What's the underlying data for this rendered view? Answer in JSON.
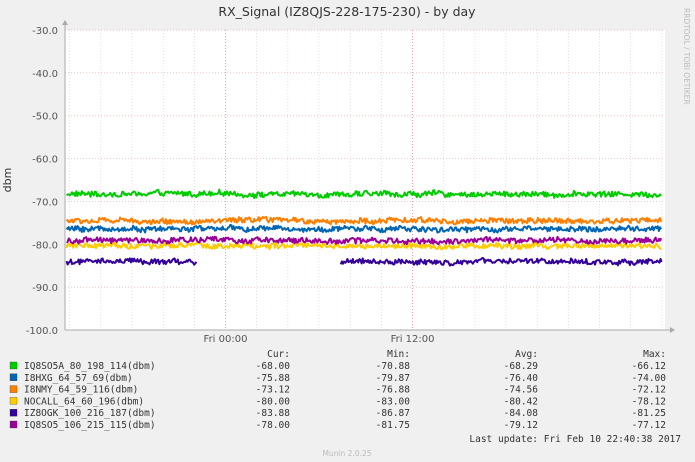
{
  "chart_data": {
    "type": "line",
    "title": "RX_Signal (IZ8QJS-228-175-230) - by day",
    "ylabel": "dbm",
    "ylim": [
      -100,
      -30
    ],
    "y_ticks": [
      "-30.0",
      "-40.0",
      "-50.0",
      "-60.0",
      "-70.0",
      "-80.0",
      "-90.0",
      "-100.0"
    ],
    "x_ticks": [
      "Fri 00:00",
      "Fri 12:00"
    ],
    "x_range_hours": [
      -10.3,
      28.2
    ],
    "grid": true,
    "side_label": "RRDTOOL / TOBI OETIKER",
    "legend_headers": {
      "cur": "Cur:",
      "min": "Min:",
      "avg": "Avg:",
      "max": "Max:"
    },
    "series": [
      {
        "name": "IQ8SO5A_80_198_114(dbm)",
        "color": "#00cc00",
        "base": -68.29,
        "noise": 0.6,
        "segments": [
          [
            -10.2,
            28.0
          ]
        ],
        "cur": "-68.00",
        "min": "-70.88",
        "avg": "-68.29",
        "max": "-66.12"
      },
      {
        "name": "I8HXG_64_57_69(dbm)",
        "color": "#0066b3",
        "base": -76.4,
        "noise": 0.6,
        "segments": [
          [
            -10.2,
            28.0
          ]
        ],
        "cur": "-75.88",
        "min": "-79.87",
        "avg": "-76.40",
        "max": "-74.00"
      },
      {
        "name": "I8NMY_64_59_116(dbm)",
        "color": "#ff8000",
        "base": -74.56,
        "noise": 0.6,
        "segments": [
          [
            -10.2,
            28.0
          ]
        ],
        "cur": "-73.12",
        "min": "-76.88",
        "avg": "-74.56",
        "max": "-72.12"
      },
      {
        "name": "NOCALL_64_60_196(dbm)",
        "color": "#ffcc00",
        "base": -80.42,
        "noise": 0.6,
        "segments": [
          [
            -10.2,
            28.0
          ]
        ],
        "cur": "-80.00",
        "min": "-83.00",
        "avg": "-80.42",
        "max": "-78.12"
      },
      {
        "name": "IZ8OGK_100_216_187(dbm)",
        "color": "#330099",
        "base": -84.08,
        "noise": 0.6,
        "segments": [
          [
            -10.2,
            -1.8
          ],
          [
            7.4,
            28.0
          ]
        ],
        "cur": "-83.88",
        "min": "-86.87",
        "avg": "-84.08",
        "max": "-81.25"
      },
      {
        "name": "IQ8SO5_106_215_115(dbm)",
        "color": "#990099",
        "base": -79.12,
        "noise": 0.6,
        "segments": [
          [
            -10.2,
            28.0
          ]
        ],
        "cur": "-78.00",
        "min": "-81.75",
        "avg": "-79.12",
        "max": "-77.12"
      }
    ],
    "last_update": "Last update:  Fri Feb 10 22:40:38 2017",
    "footer": "Munin 2.0.25"
  }
}
